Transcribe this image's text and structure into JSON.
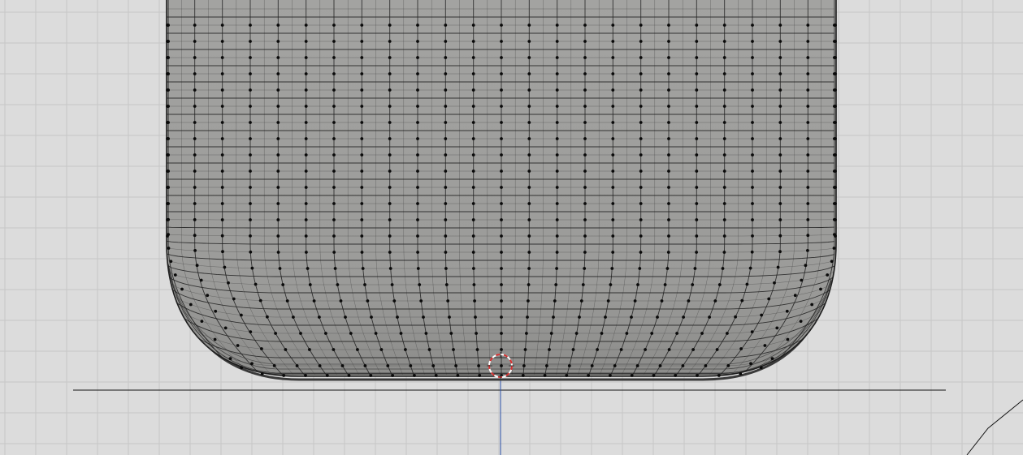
{
  "viewport": {
    "background_color": "#dcdcdc",
    "grid_color": "#c6c6c6",
    "mesh_fill_color": "#9a9a98",
    "mesh_fill_light": "#a8a8a6",
    "edge_color": "#1e1e1e",
    "vertex_color": "#0a0a0a",
    "cursor_color": "#d33030",
    "axis_line_color": "#2a4fa8",
    "floor_line_color": "#141414"
  },
  "objects": {
    "mesh": {
      "name": "subdivided-rounded-box",
      "selected_mode": "vertex"
    },
    "cursor": {
      "name": "3d-cursor-icon"
    }
  }
}
